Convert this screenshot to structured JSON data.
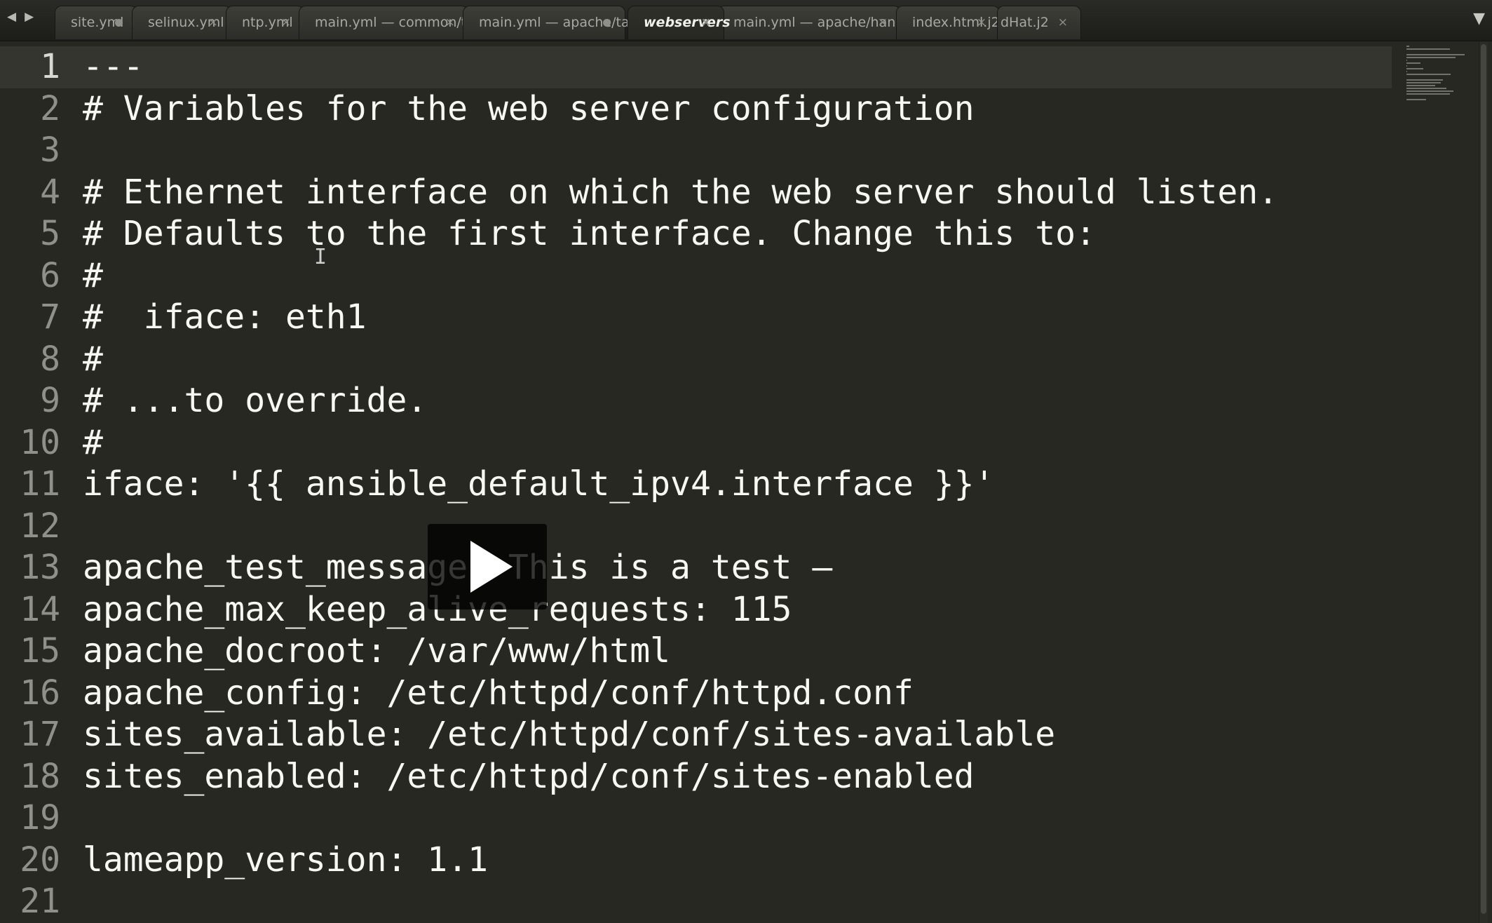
{
  "nav": {
    "back_glyph": "◀",
    "forward_glyph": "▶"
  },
  "tabs": [
    {
      "label": "site.yml",
      "state": "dirty"
    },
    {
      "label": "selinux.yml",
      "state": "close"
    },
    {
      "label": "ntp.yml",
      "state": "close"
    },
    {
      "label": "main.yml — common/tasks",
      "state": "close"
    },
    {
      "label": "main.yml — apache/tasks",
      "state": "dirty"
    },
    {
      "label": "webservers",
      "state": "close",
      "active": true
    },
    {
      "label": "main.yml — apache/handlers",
      "state": "close"
    },
    {
      "label": "index.html.j2",
      "state": "close"
    },
    {
      "label": "dHat.j2",
      "state": "close"
    }
  ],
  "tab_close_glyph": "×",
  "tab_menu_glyph": "▼",
  "editor": {
    "current_line": 1,
    "lines": [
      {
        "num": "1",
        "text": "---"
      },
      {
        "num": "2",
        "text": "# Variables for the web server configuration"
      },
      {
        "num": "3",
        "text": ""
      },
      {
        "num": "4",
        "text": "# Ethernet interface on which the web server should listen."
      },
      {
        "num": "5",
        "text": "# Defaults to the first interface. Change this to:"
      },
      {
        "num": "6",
        "text": "#"
      },
      {
        "num": "7",
        "text": "#  iface: eth1"
      },
      {
        "num": "8",
        "text": "#"
      },
      {
        "num": "9",
        "text": "# ...to override."
      },
      {
        "num": "10",
        "text": "#"
      },
      {
        "num": "11",
        "text": "iface: '{{ ansible_default_ipv4.interface }}'"
      },
      {
        "num": "12",
        "text": ""
      },
      {
        "num": "13",
        "text": "apache_test_message: This is a test –"
      },
      {
        "num": "14",
        "text": "apache_max_keep_alive_requests: 115"
      },
      {
        "num": "15",
        "text": "apache_docroot: /var/www/html"
      },
      {
        "num": "16",
        "text": "apache_config: /etc/httpd/conf/httpd.conf"
      },
      {
        "num": "17",
        "text": "sites_available: /etc/httpd/conf/sites-available"
      },
      {
        "num": "18",
        "text": "sites_enabled: /etc/httpd/conf/sites-enabled"
      },
      {
        "num": "19",
        "text": ""
      },
      {
        "num": "20",
        "text": "lameapp_version: 1.1"
      },
      {
        "num": "21",
        "text": ""
      }
    ]
  },
  "cursor_glyph": "I",
  "colors": {
    "editor_bg": "#272822",
    "text": "#f8f8f2",
    "gutter": "#8f908a",
    "current_line_bg": "#34352f"
  }
}
